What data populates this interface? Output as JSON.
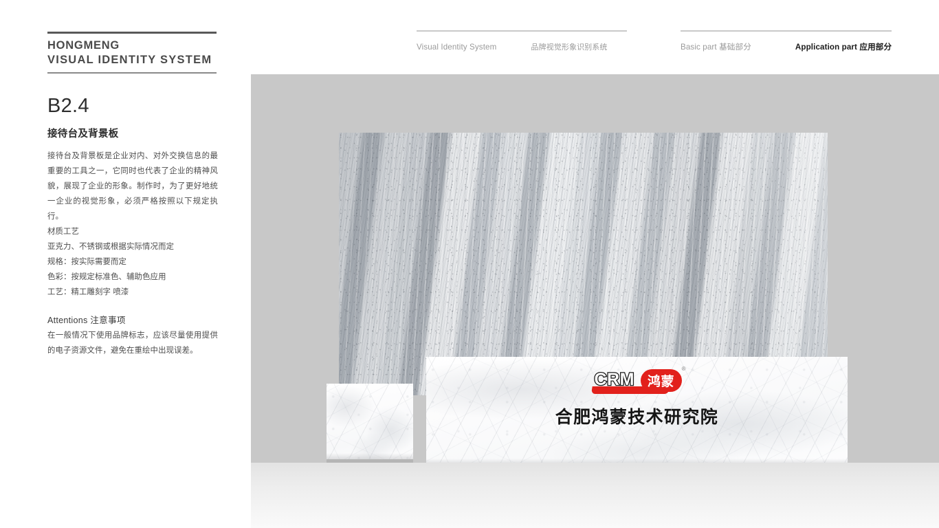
{
  "brand": {
    "line1": "HONGMENG",
    "line2": "VISUAL IDENTITY SYSTEM"
  },
  "header": {
    "left_group": {
      "en": "Visual Identity System",
      "cn": "品牌视觉形象识别系统"
    },
    "right_group": {
      "basic_en": "Basic part",
      "basic_cn": "基础部分",
      "application_en": "Application part",
      "application_cn": "应用部分"
    }
  },
  "section": {
    "number": "B2.4",
    "title": "接待台及背景板",
    "paragraph": "接待台及背景板是企业对内、对外交换信息的最重要的工具之一，它同时也代表了企业的精神风貌，展现了企业的形象。制作时，为了更好地统一企业的视觉形象，必须严格按照以下规定执行。",
    "specs": [
      "材质工艺",
      "亚克力、不锈钢或根据实际情况而定",
      "规格：按实际需要而定",
      "色彩：按规定标准色、辅助色应用",
      "工艺：精工雕刻字 喷漆"
    ],
    "attentions_heading": "Attentions 注意事项",
    "attentions_body": "在一般情况下使用品牌标志，应该尽量使用提供的电子资源文件，避免在重绘中出现误差。"
  },
  "mockup": {
    "logo": {
      "latin": "CRM",
      "chinese": "鸿蒙",
      "registered_mark": "®"
    },
    "company_name": "合肥鸿蒙技术研究院"
  },
  "colors": {
    "brand_red": "#e2211c",
    "text_dark": "#2d2d2d",
    "text_body": "#4d4d4d",
    "nav_muted": "#9a9a9a",
    "scene_bg": "#c8c8c8"
  }
}
